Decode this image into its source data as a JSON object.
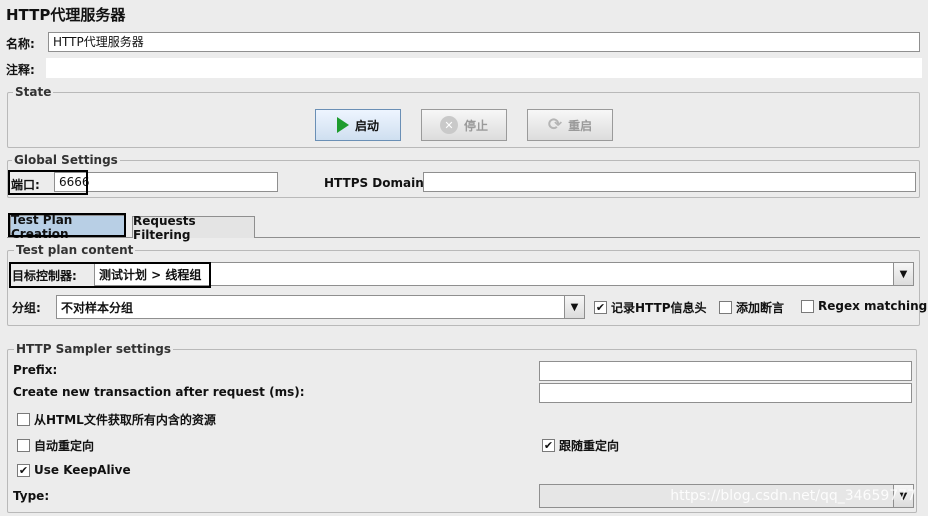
{
  "window_title": "HTTP代理服务器",
  "name_field": {
    "label": "名称:",
    "value": "HTTP代理服务器"
  },
  "comment_field": {
    "label": "注释:",
    "value": ""
  },
  "state": {
    "legend": "State",
    "start_label": "启动",
    "stop_label": "停止",
    "restart_label": "重启"
  },
  "global_settings": {
    "legend": "Global Settings",
    "port_label": "端口:",
    "port_value": "6666",
    "https_label": "HTTPS Domains:",
    "https_value": ""
  },
  "tabs": [
    {
      "label": "Test Plan Creation",
      "active": true
    },
    {
      "label": "Requests Filtering",
      "active": false
    }
  ],
  "test_plan_content": {
    "legend": "Test plan content",
    "target_label": "目标控制器:",
    "target_value": "测试计划 > 线程组",
    "group_label": "分组:",
    "group_value": "不对样本分组",
    "record_headers": {
      "label": "记录HTTP信息头",
      "checked": true
    },
    "add_assertions": {
      "label": "添加断言",
      "checked": false
    },
    "regex_matching": {
      "label": "Regex matching",
      "checked": false
    }
  },
  "sampler_settings": {
    "legend": "HTTP Sampler settings",
    "prefix_label": "Prefix:",
    "prefix_value": "",
    "transaction_label": "Create new transaction after request (ms):",
    "transaction_value": "",
    "fetch_resources": {
      "label": "从HTML文件获取所有内含的资源",
      "checked": false
    },
    "auto_redirect": {
      "label": "自动重定向",
      "checked": false
    },
    "follow_redirect": {
      "label": "跟随重定向",
      "checked": true
    },
    "keepalive": {
      "label": "Use KeepAlive",
      "checked": true
    },
    "type_label": "Type:",
    "type_value": ""
  },
  "watermark": "https://blog.csdn.net/qq_34659777",
  "colors": {
    "active_tab": "#b8cfe5",
    "start_icon": "#1e9c2e",
    "background": "#ececec"
  }
}
